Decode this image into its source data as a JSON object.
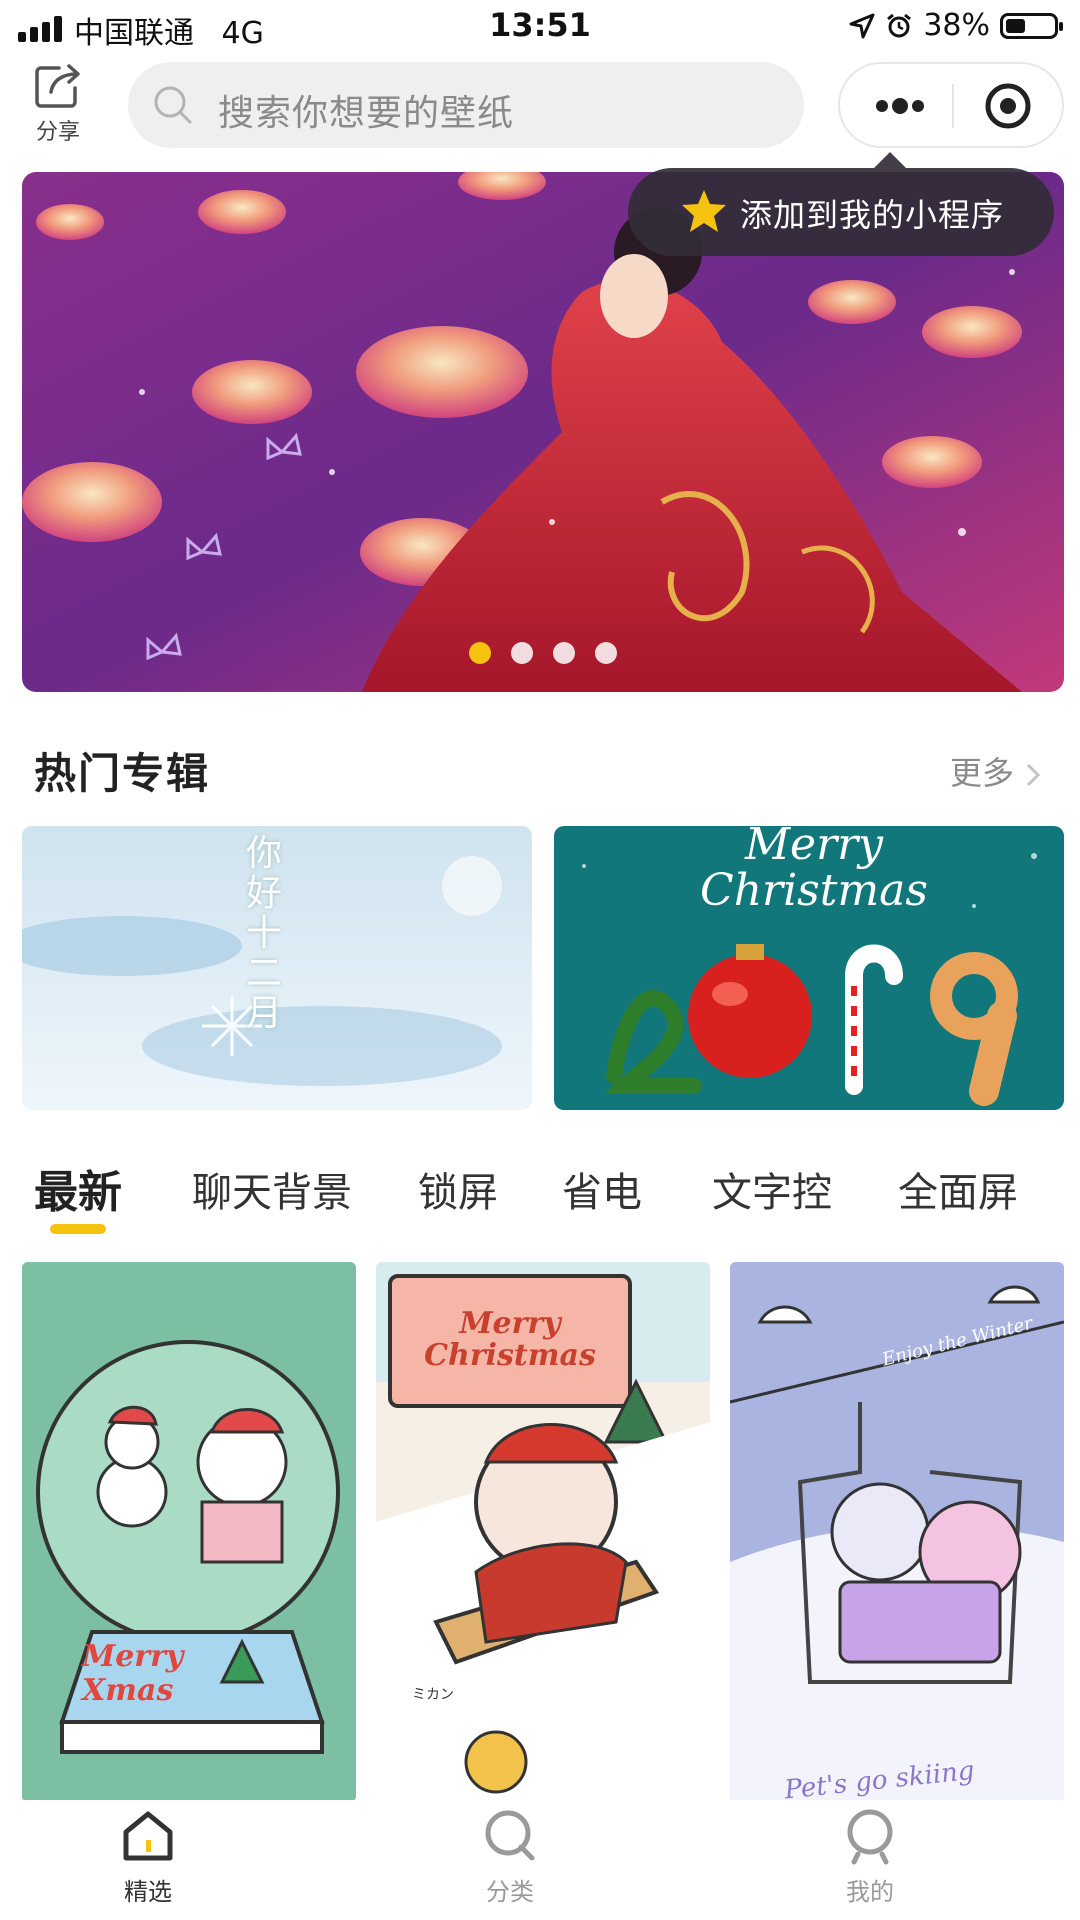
{
  "status_bar": {
    "carrier": "中国联通",
    "network": "4G",
    "time": "13:51",
    "battery_percent": "38%",
    "battery_level": 0.38
  },
  "header": {
    "share_label": "分享",
    "search_placeholder": "搜索你想要的壁纸",
    "more_icon": "more-dots-icon",
    "close_icon": "target-circle-icon"
  },
  "tooltip": {
    "text": "添加到我的小程序",
    "icon": "star-icon",
    "icon_color": "#f5c30f"
  },
  "banner": {
    "slide_count": 4,
    "active_index": 0,
    "active_dot_color": "#f5c30f"
  },
  "hot_albums": {
    "title": "热门专辑",
    "more_label": "更多",
    "album_1_text": [
      "你",
      "好",
      "十",
      "二",
      "月"
    ],
    "album_2_text": {
      "line1": "Merry",
      "line2": "Christmas",
      "year": "2019"
    }
  },
  "tabs": {
    "items": [
      "最新",
      "聊天背景",
      "锁屏",
      "省电",
      "文字控",
      "全面屏"
    ],
    "active_index": 0,
    "indicator_color": "#f5c30f"
  },
  "cards": {
    "card_1_text": "Merry Xmas",
    "card_2_text": "Merry Christmas",
    "card_2_sub": "ミカン",
    "card_3_top": "Enjoy the Winter",
    "card_3_bottom": "Pet's go skiing"
  },
  "bottom_nav": {
    "items": [
      {
        "label": "精选",
        "icon": "home-icon"
      },
      {
        "label": "分类",
        "icon": "search-icon"
      },
      {
        "label": "我的",
        "icon": "profile-icon"
      }
    ],
    "active_index": 0
  }
}
